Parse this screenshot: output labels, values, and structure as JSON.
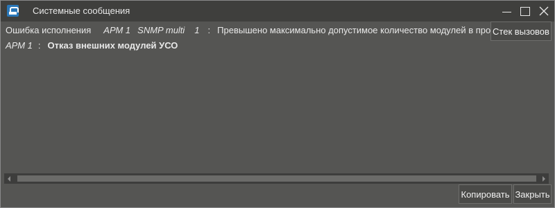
{
  "window": {
    "title": "Системные сообщения"
  },
  "message1": {
    "category": "Ошибка исполнения",
    "arm": "АРМ 1",
    "source": "SNMP multi",
    "number": "1",
    "separator": ":",
    "text": "Превышено максимально допустимое количество модулей в протоколе"
  },
  "message2": {
    "arm": "АРМ 1",
    "separator": ":",
    "text": "Отказ внешних модулей УСО"
  },
  "buttons": {
    "stack_label": "Стек вызовов",
    "copy_label": "Копировать",
    "close_label": "Закрыть"
  },
  "colors": {
    "background": "#555553",
    "titlebar": "#3f3f3d",
    "text": "#e8e8e8",
    "icon_accent": "#2a77b8"
  }
}
